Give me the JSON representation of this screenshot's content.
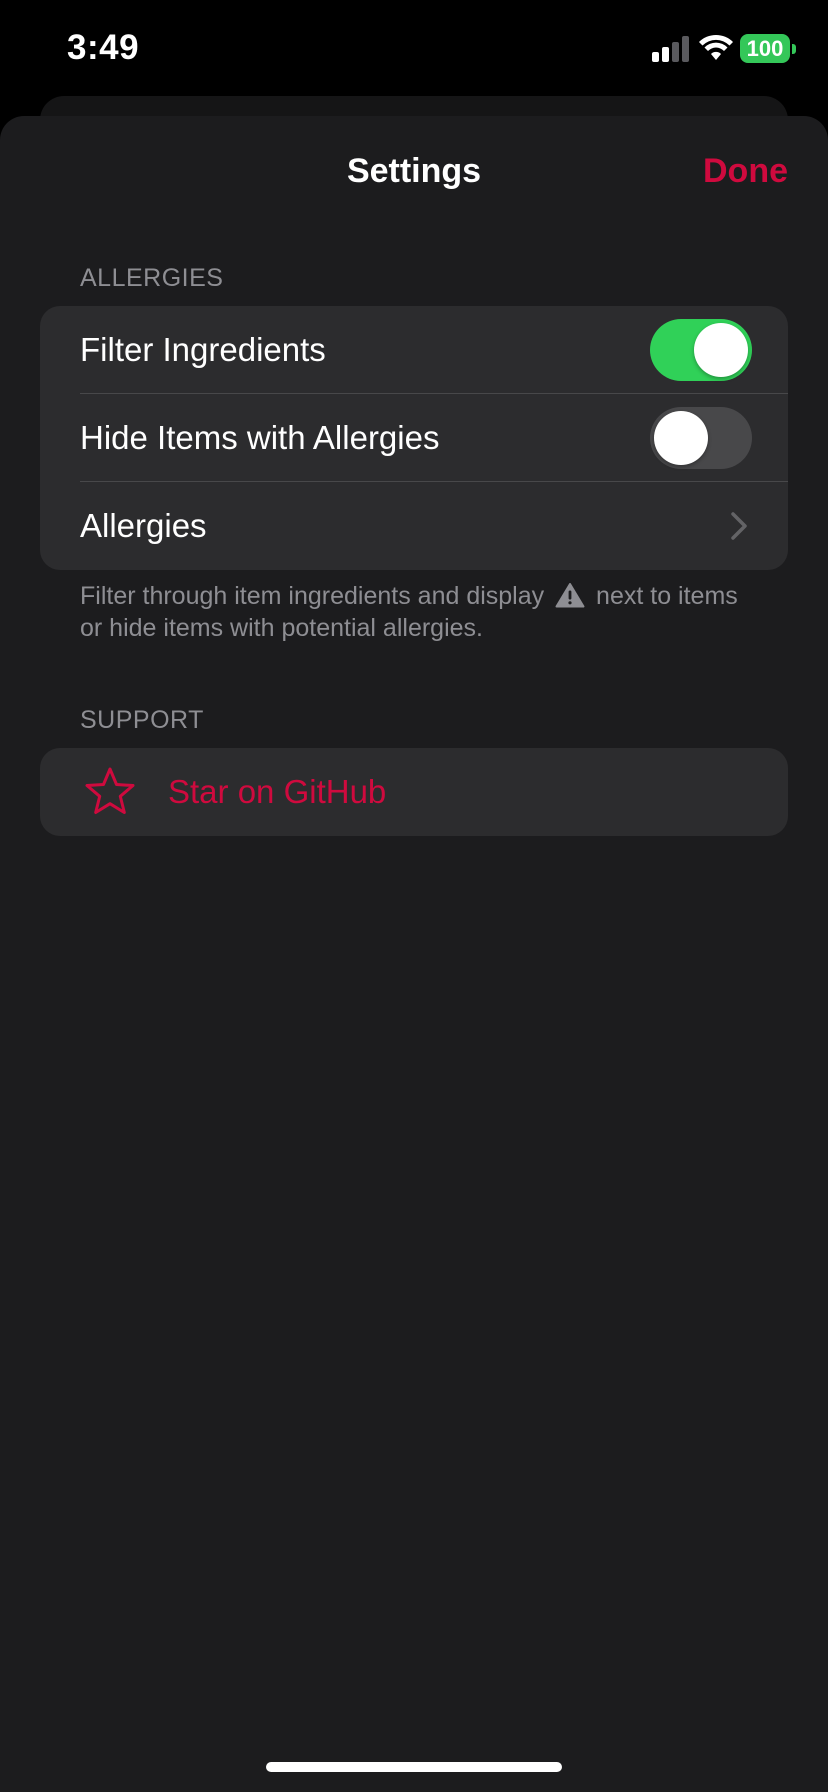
{
  "status_bar": {
    "time": "3:49",
    "battery": "100"
  },
  "nav": {
    "title": "Settings",
    "done_label": "Done"
  },
  "allergies_section": {
    "header": "ALLERGIES",
    "rows": [
      {
        "label": "Filter Ingredients",
        "toggle_on": true
      },
      {
        "label": "Hide Items with Allergies",
        "toggle_on": false
      },
      {
        "label": "Allergies"
      }
    ],
    "footer_part1": "Filter through item ingredients and display",
    "footer_part2": "next to items or hide items with potential allergies."
  },
  "support_section": {
    "header": "SUPPORT",
    "github_label": "Star on GitHub",
    "icon": "star-icon"
  },
  "colors": {
    "accent": "#cf0a3e",
    "toggle_on": "#30d158",
    "background": "#1c1c1e",
    "group_background": "#2c2c2e"
  }
}
